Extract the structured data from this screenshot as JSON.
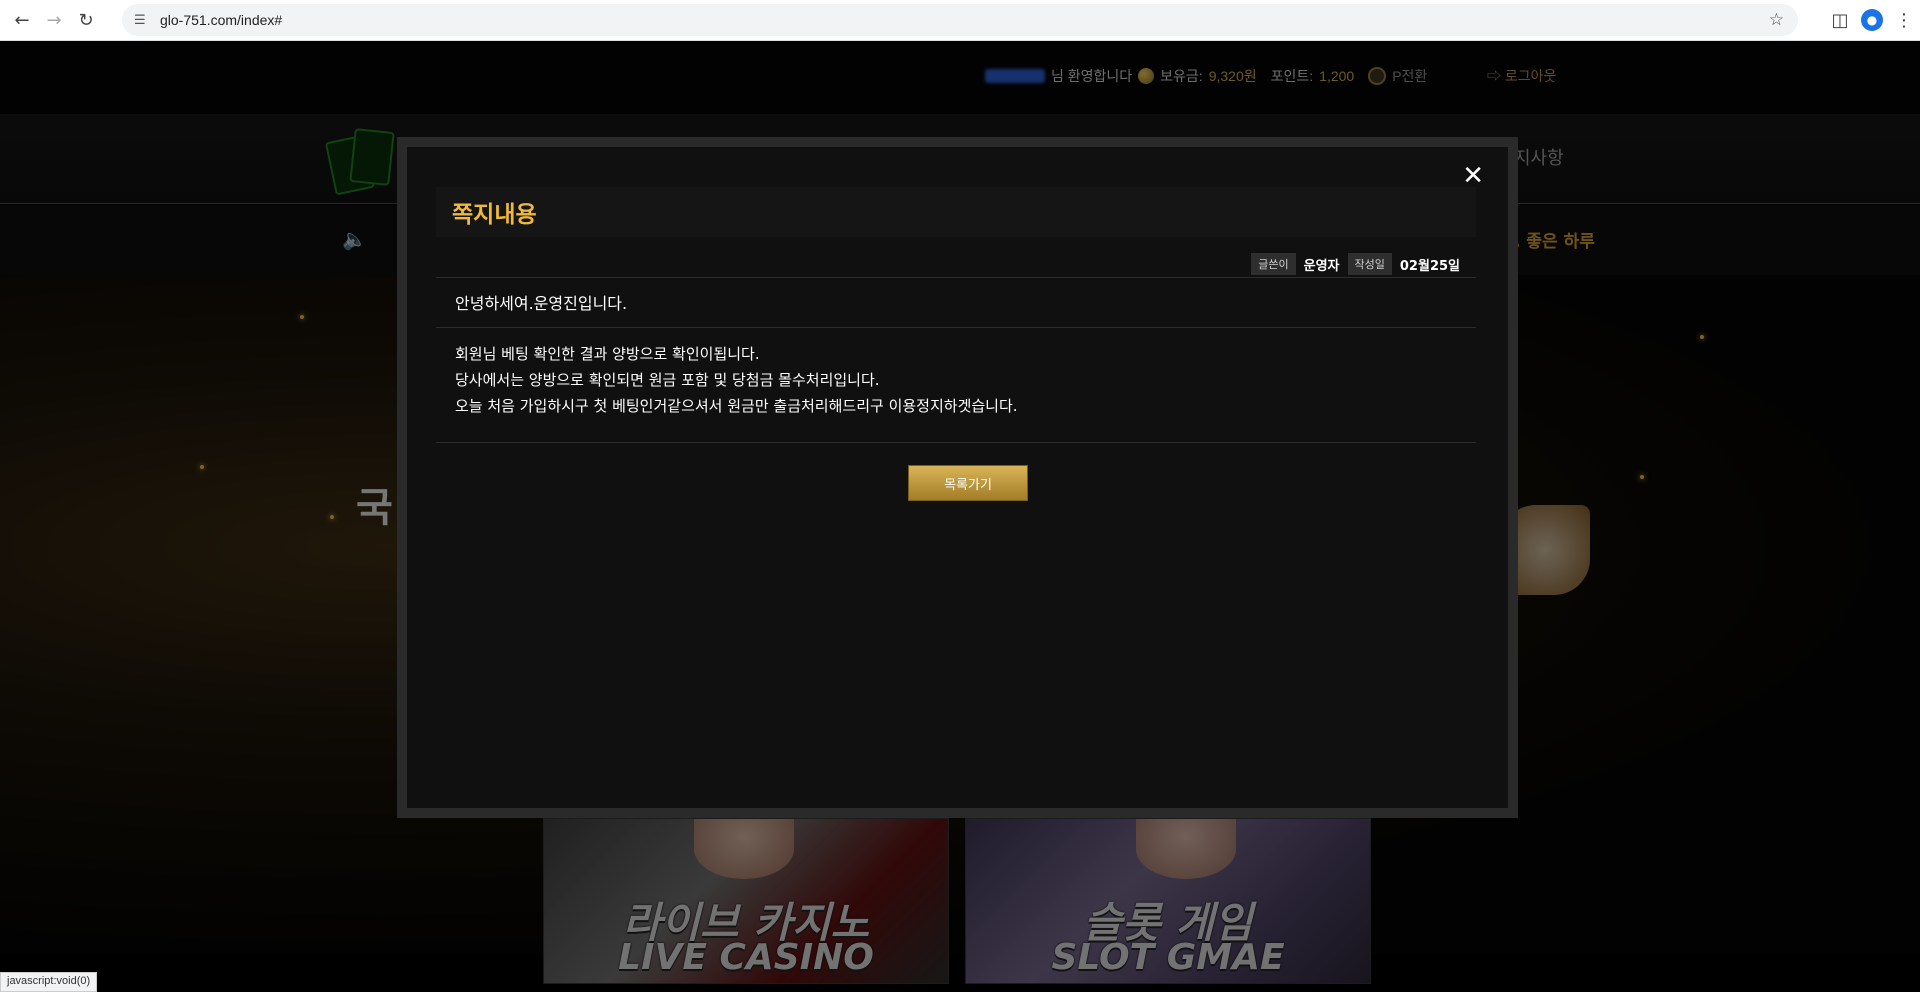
{
  "browser": {
    "url": "glo-751.com/index#",
    "status_url": "javascript:void(0)"
  },
  "header": {
    "welcome_suffix": "님 환영합니다",
    "balance_label": "보유금:",
    "balance_value": "9,320원",
    "points_label": "포인트:",
    "points_value": "1,200",
    "convert_label": "P전환",
    "logout_label": "로그아웃"
  },
  "nav": {
    "partial_item": "지사항"
  },
  "notice": {
    "ticker_text": ". 좋은 하루"
  },
  "hero": {
    "title_partial": "국"
  },
  "tiles": [
    {
      "kr": "라이브 카지노",
      "en": "LIVE CASINO"
    },
    {
      "kr": "슬롯 게임",
      "en": "SLOT GMAE"
    }
  ],
  "modal": {
    "title": "쪽지내용",
    "author_label": "글쓴이",
    "author_value": "운영자",
    "date_label": "작성일",
    "date_value": "02월25일",
    "subject": "안녕하세여.운영진입니다.",
    "body": [
      "회원님 베팅 확인한 결과 양방으로 확인이됩니다.",
      "당사에서는 양방으로 확인되면 원금 포함 및 당첨금 몰수처리입니다.",
      "오늘 처음 가입하시구 첫 베팅인거같으셔서 원금만 출금처리해드리구 이용정지하겟습니다."
    ],
    "back_button": "목록가기"
  },
  "colors": {
    "accent_gold": "#f0b93a",
    "button_gold": "#c9a246",
    "modal_bg": "#101010"
  }
}
